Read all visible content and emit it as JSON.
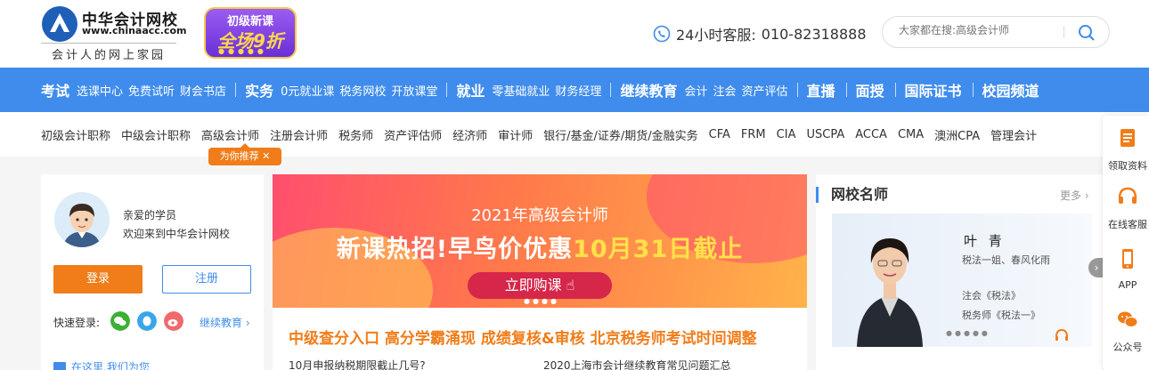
{
  "brand": {
    "name": "中华会计网校",
    "url": "www.chinaacc.com",
    "slogan": "会计人的网上家园"
  },
  "promo": {
    "line1": "初级新课",
    "line2": "全场9折"
  },
  "hotline": {
    "label": "24小时客服:",
    "number": "010-82318888"
  },
  "search": {
    "placeholder": "大家都在搜:高级会计师"
  },
  "nav": {
    "groups": [
      {
        "title": "考试",
        "items": [
          "选课中心",
          "免费试听",
          "财会书店"
        ]
      },
      {
        "title": "实务",
        "items": [
          "0元就业课",
          "税务网校",
          "开放课堂"
        ]
      },
      {
        "title": "就业",
        "items": [
          "零基础就业",
          "财务经理"
        ]
      },
      {
        "title": "继续教育",
        "items": [
          "会计",
          "注会",
          "资产评估"
        ]
      },
      {
        "title": "直播",
        "items": []
      },
      {
        "title": "面授",
        "items": []
      },
      {
        "title": "国际证书",
        "items": []
      },
      {
        "title": "校园频道",
        "items": []
      }
    ]
  },
  "subnav": [
    "初级会计职称",
    "中级会计职称",
    "高级会计师",
    "注册会计师",
    "税务师",
    "资产评估师",
    "经济师",
    "审计师",
    "银行/基金/证券/期货/金融实务",
    "CFA",
    "FRM",
    "CIA",
    "USCPA",
    "ACCA",
    "CMA",
    "澳洲CPA",
    "管理会计"
  ],
  "recommend": "为你推荐 ✕",
  "user": {
    "greeting1": "亲爱的学员",
    "greeting2": "欢迎来到中华会计网校",
    "login": "登录",
    "register": "注册",
    "quick_login": "快速登录:",
    "continue": "继续教育 ›",
    "here": "在这里,我们为您"
  },
  "banner": {
    "title": "2021年高级会计师",
    "headline_a": "新课热招!早鸟价优惠",
    "headline_b": "10月31日截止",
    "cta": "立即购课"
  },
  "news": {
    "headline": "中级查分入口  高分学霸涌现  成绩复核&审核  北京税务师考试时间调整",
    "item1": "10月申报纳税期限截止几号?",
    "item2": "2020上海市会计继续教育常见问题汇总"
  },
  "teacher": {
    "section_title": "网校名师",
    "more": "更多 ›",
    "name": "叶 青",
    "tagline": "税法一姐、春风化雨",
    "course1": "注会《税法》",
    "course2": "税务师《税法一》"
  },
  "sidebar": [
    {
      "label": "领取资料",
      "icon": "document-icon"
    },
    {
      "label": "在线客服",
      "icon": "headset-icon"
    },
    {
      "label": "APP",
      "icon": "phone-icon"
    },
    {
      "label": "公众号",
      "icon": "wechat-icon"
    }
  ],
  "colors": {
    "blue": "#3f8cec",
    "orange": "#f07d1a"
  }
}
